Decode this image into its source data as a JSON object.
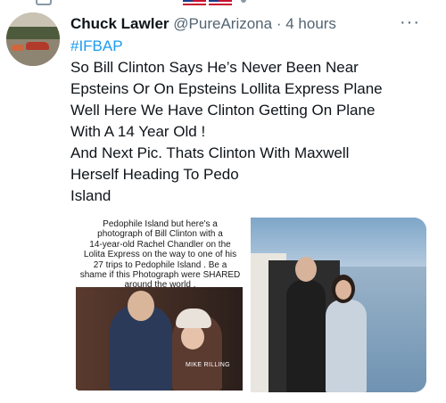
{
  "tweet": {
    "author_name": "Chuck Lawler",
    "handle": "@PureArizona",
    "separator": "·",
    "time": "4 hours",
    "more_glyph": "···",
    "hashtag": "#IFBAP",
    "lines": [
      "So Bill Clinton Says He’s Never Been Near",
      "Epsteins Or On Epsteins Lollita Express Plane",
      "Well Here We Have Clinton Getting On Plane",
      "With A 14 Year Old !",
      "And Next Pic. Thats Clinton With Maxwell",
      "Herself Heading To Pedo",
      "Island"
    ]
  },
  "media": {
    "image1": {
      "caption_lines": [
        "Pedophile Island but here's a",
        "photograph of Bill Clinton with a",
        "14-year-old Rachel Chandler on the",
        "Lolita Express on the way to one of his",
        "27 trips to Pedophile Island . Be a",
        "shame if this Photograph were SHARED",
        "around the world ."
      ],
      "credit": "MIKE RILLING"
    }
  },
  "colors": {
    "accent": "#1d9bf0",
    "secondary_text": "#536471",
    "primary_text": "#0f1419"
  },
  "icons": {
    "top_retweet": "retweet-icon",
    "more": "more-options-icon"
  }
}
